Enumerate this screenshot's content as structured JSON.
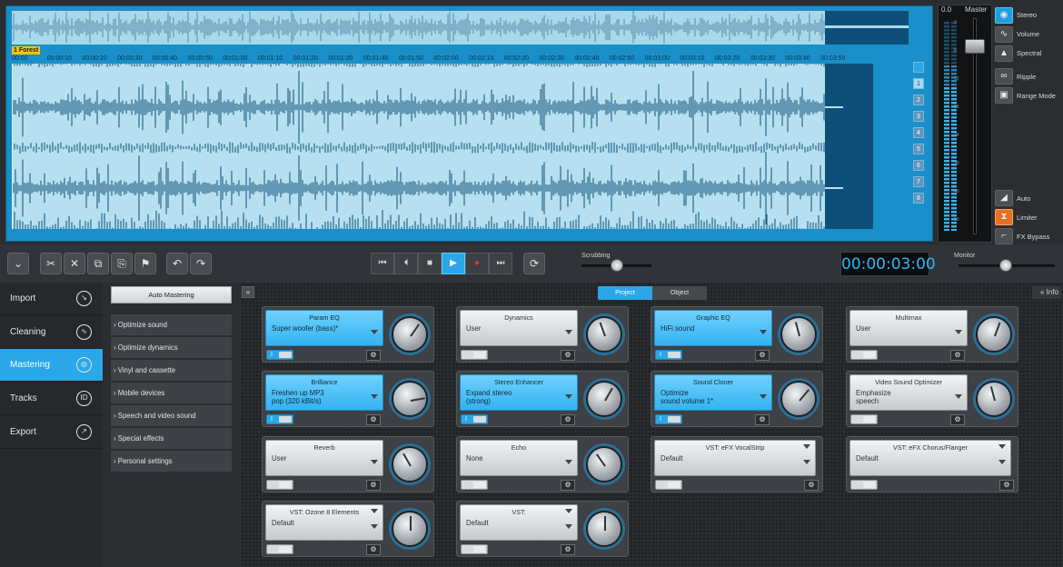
{
  "waveform": {
    "marker_label": "1 Forest",
    "ruler_ticks": [
      "00:00",
      "00:00:10",
      "00:00:20",
      "00:00:30",
      "00:00:40",
      "00:00:50",
      "00:01:00",
      "00:01:10",
      "00:01:20",
      "00:01:30",
      "00:01:40",
      "00:01:50",
      "00:02:00",
      "00:02:10",
      "00:02:20",
      "00:02:30",
      "00:02:40",
      "00:02:50",
      "00:03:00",
      "00:03:10",
      "00:03:20",
      "00:03:30",
      "00:03:40",
      "00:03:50"
    ],
    "track_numbers": [
      "1",
      "2",
      "3",
      "4",
      "5",
      "6",
      "7",
      "8"
    ]
  },
  "meter": {
    "value": "0.0",
    "master_label": "Master",
    "db_marks": [
      "0",
      "6",
      "12",
      "18",
      "24",
      "30",
      "40",
      "50"
    ]
  },
  "right_tools": {
    "stereo": "Stereo",
    "volume": "Volume",
    "spectral": "Spectral",
    "ripple": "Ripple",
    "range_mode": "Range Mode",
    "auto": "Auto",
    "limiter": "Limiter",
    "fx_bypass": "FX Bypass"
  },
  "toolbar": {
    "scrubbing_label": "Scrubbing",
    "time": "00:00:03:00",
    "monitor_label": "Monitor",
    "icons": {
      "collapse": "⌄",
      "cut": "✂",
      "delete": "✕",
      "copy": "⧉",
      "paste": "⎘",
      "flag": "⚑",
      "undo": "↶",
      "redo": "↷",
      "skip_back": "⏮",
      "prev": "⏴",
      "stop": "■",
      "play": "▶",
      "record": "●",
      "next": "⏭",
      "loop": "⟳"
    }
  },
  "nav": {
    "items": [
      {
        "label": "Import",
        "icon": "↘"
      },
      {
        "label": "Cleaning",
        "icon": "∿"
      },
      {
        "label": "Mastering",
        "icon": "◎"
      },
      {
        "label": "Tracks",
        "icon": "ID"
      },
      {
        "label": "Export",
        "icon": "↗"
      }
    ]
  },
  "mastering": {
    "auto_button": "Auto Mastering",
    "items": [
      "› Optimize sound",
      "› Optimize dynamics",
      "› Vinyl and cassette",
      "› Mobile devices",
      "› Speech and video sound",
      "› Special effects",
      "› Personal settings"
    ]
  },
  "fx_header": {
    "collapse": "«",
    "tab_project": "Project",
    "tab_object": "Object",
    "info": "« Info"
  },
  "fx": [
    {
      "title": "Param EQ",
      "value": "Super woofer (bass)*",
      "on": "I"
    },
    {
      "title": "Dynamics",
      "value": "User",
      "on": ""
    },
    {
      "title": "Graphic EQ",
      "value": "HiFi sound",
      "on": "I"
    },
    {
      "title": "Multimax",
      "value": "User",
      "on": ""
    },
    {
      "title": "Brilliance",
      "value": "Freshen up MP3\npop (320 kBit/s)",
      "on": "I"
    },
    {
      "title": "Stereo Enhancer",
      "value": "Expand stereo\n(strong)",
      "on": "I"
    },
    {
      "title": "Sound Cloner",
      "value": "Optimize\nsound volume 1*",
      "on": "I"
    },
    {
      "title": "Video Sound Optimizer",
      "value": "Emphasize\nspeech",
      "on": ""
    },
    {
      "title": "Reverb",
      "value": "User",
      "on": ""
    },
    {
      "title": "Echo",
      "value": "None",
      "on": ""
    },
    {
      "title": "VST: eFX VocalStrip",
      "value": "Default",
      "on": ""
    },
    {
      "title": "VST: eFX Chorus/Flanger",
      "value": "Default",
      "on": ""
    },
    {
      "title": "VST: Ozone 8 Elements",
      "value": "Default",
      "on": ""
    },
    {
      "title": "VST:",
      "value": "Default",
      "on": ""
    }
  ],
  "gear_icon": "⚙"
}
